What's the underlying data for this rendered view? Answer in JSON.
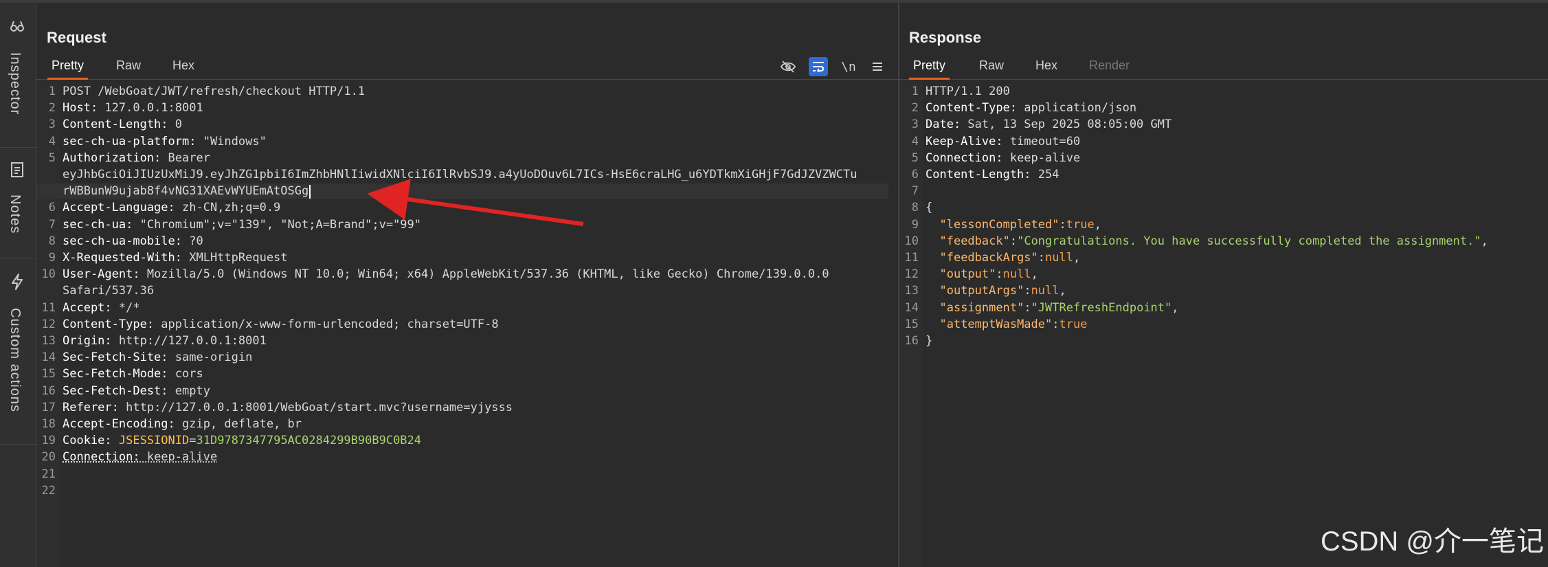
{
  "sidebar": {
    "tabs": [
      {
        "label": "Inspector",
        "icon": "inspector-icon"
      },
      {
        "label": "Notes",
        "icon": "notes-icon"
      },
      {
        "label": "Custom actions",
        "icon": "lightning-icon"
      }
    ]
  },
  "request": {
    "title": "Request",
    "tabs": [
      "Pretty",
      "Raw",
      "Hex"
    ],
    "active_tab": "Pretty",
    "toolbar": {
      "hide_icon": "eye-off-icon",
      "wrap_icon": "wrap-icon",
      "newline_label": "\\n",
      "menu_icon": "menu-icon"
    },
    "lines": [
      {
        "n": "1",
        "text": "POST /WebGoat/JWT/refresh/checkout HTTP/1.1"
      },
      {
        "n": "2",
        "name": "Host",
        "value": "127.0.0.1:8001"
      },
      {
        "n": "3",
        "name": "Content-Length",
        "value": "0"
      },
      {
        "n": "4",
        "name": "sec-ch-ua-platform",
        "value": "\"Windows\""
      },
      {
        "n": "5",
        "name": "Authorization",
        "value": "Bearer"
      },
      {
        "n": "",
        "text": "eyJhbGciOiJIUzUxMiJ9.eyJhZG1pbiI6ImZhbHNlIiwidXNlciI6IlRvbSJ9.a4yUoDOuv6L7ICs-HsE6craLHG_u6YDTkmXiGHjF7GdJZVZWCTu"
      },
      {
        "n": "",
        "text": "rWBBunW9ujab8f4vNG31XAEvWYUEmAtOSGg"
      },
      {
        "n": "6",
        "name": "Accept-Language",
        "value": "zh-CN,zh;q=0.9"
      },
      {
        "n": "7",
        "name": "sec-ch-ua",
        "value": "\"Chromium\";v=\"139\", \"Not;A=Brand\";v=\"99\""
      },
      {
        "n": "8",
        "name": "sec-ch-ua-mobile",
        "value": "?0"
      },
      {
        "n": "9",
        "name": "X-Requested-With",
        "value": "XMLHttpRequest"
      },
      {
        "n": "10",
        "name": "User-Agent",
        "value": "Mozilla/5.0 (Windows NT 10.0; Win64; x64) AppleWebKit/537.36 (KHTML, like Gecko) Chrome/139.0.0.0"
      },
      {
        "n": "",
        "text": "Safari/537.36"
      },
      {
        "n": "11",
        "name": "Accept",
        "value": "*/*"
      },
      {
        "n": "12",
        "name": "Content-Type",
        "value": "application/x-www-form-urlencoded; charset=UTF-8"
      },
      {
        "n": "13",
        "name": "Origin",
        "value": "http://127.0.0.1:8001"
      },
      {
        "n": "14",
        "name": "Sec-Fetch-Site",
        "value": "same-origin"
      },
      {
        "n": "15",
        "name": "Sec-Fetch-Mode",
        "value": "cors"
      },
      {
        "n": "16",
        "name": "Sec-Fetch-Dest",
        "value": "empty"
      },
      {
        "n": "17",
        "name": "Referer",
        "value": "http://127.0.0.1:8001/WebGoat/start.mvc?username=yjysss"
      },
      {
        "n": "18",
        "name": "Accept-Encoding",
        "value": "gzip, deflate, br"
      },
      {
        "n": "19",
        "name": "Cookie",
        "cookie_name": "JSESSIONID",
        "cookie_value": "31D9787347795AC0284299B90B9C0B24"
      },
      {
        "n": "20",
        "name": "Connection",
        "value": "keep-alive"
      },
      {
        "n": "21",
        "text": ""
      },
      {
        "n": "22",
        "text": ""
      }
    ]
  },
  "response": {
    "title": "Response",
    "tabs": [
      "Pretty",
      "Raw",
      "Hex",
      "Render"
    ],
    "active_tab": "Pretty",
    "lines": [
      {
        "n": "1",
        "text": "HTTP/1.1 200"
      },
      {
        "n": "2",
        "name": "Content-Type",
        "value": "application/json"
      },
      {
        "n": "3",
        "name": "Date",
        "value": "Sat, 13 Sep 2025 08:05:00 GMT"
      },
      {
        "n": "4",
        "name": "Keep-Alive",
        "value": "timeout=60"
      },
      {
        "n": "5",
        "name": "Connection",
        "value": "keep-alive"
      },
      {
        "n": "6",
        "name": "Content-Length",
        "value": "254"
      },
      {
        "n": "7",
        "text": ""
      },
      {
        "n": "8",
        "text": "{"
      },
      {
        "n": "9",
        "jkey": "\"lessonCompleted\"",
        "jval": "true",
        "jtype": "kw",
        "comma": ","
      },
      {
        "n": "10",
        "jkey": "\"feedback\"",
        "jval": "\"Congratulations. You have successfully completed the assignment.\"",
        "jtype": "str",
        "comma": ","
      },
      {
        "n": "11",
        "jkey": "\"feedbackArgs\"",
        "jval": "null",
        "jtype": "kw",
        "comma": ","
      },
      {
        "n": "12",
        "jkey": "\"output\"",
        "jval": "null",
        "jtype": "kw",
        "comma": ","
      },
      {
        "n": "13",
        "jkey": "\"outputArgs\"",
        "jval": "null",
        "jtype": "kw",
        "comma": ","
      },
      {
        "n": "14",
        "jkey": "\"assignment\"",
        "jval": "\"JWTRefreshEndpoint\"",
        "jtype": "str",
        "comma": ","
      },
      {
        "n": "15",
        "jkey": "\"attemptWasMade\"",
        "jval": "true",
        "jtype": "kw",
        "comma": ""
      },
      {
        "n": "16",
        "text": "}"
      }
    ]
  },
  "annotation": {
    "arrow_color": "#e02424"
  },
  "watermark": "CSDN @介一笔记"
}
